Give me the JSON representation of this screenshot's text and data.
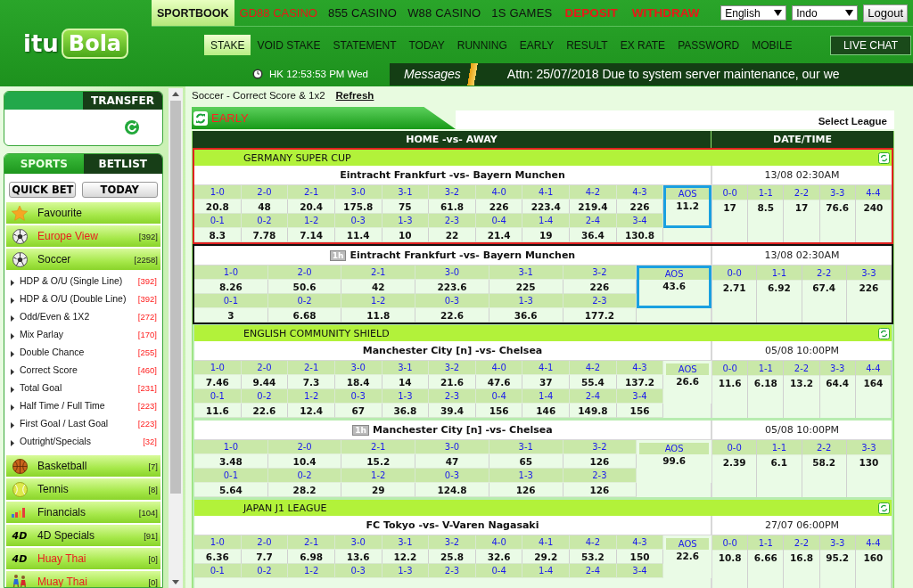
{
  "header": {
    "logo": {
      "part_1": "itu",
      "part_2": "Bola"
    },
    "top_nav": [
      {
        "label": "SPORTBOOK",
        "selected": true,
        "kind": "normal"
      },
      {
        "label": "GD88 CASINO",
        "selected": false,
        "kind": "promo"
      },
      {
        "label": "855 CASINO",
        "selected": false,
        "kind": "normal"
      },
      {
        "label": "W88 CASINO",
        "selected": false,
        "kind": "normal"
      },
      {
        "label": "1S GAMES",
        "selected": false,
        "kind": "normal"
      },
      {
        "label": "DEPOSIT",
        "selected": false,
        "kind": "alert"
      },
      {
        "label": "WITHDRAW",
        "selected": false,
        "kind": "alert"
      }
    ],
    "language_select": "English",
    "odds_select": "Indo",
    "logout": "Logout",
    "sub_nav": [
      {
        "label": "STAKE",
        "selected": true
      },
      {
        "label": "VOID STAKE",
        "selected": false
      },
      {
        "label": "STATEMENT",
        "selected": false
      },
      {
        "label": "TODAY",
        "selected": false
      },
      {
        "label": "RUNNING",
        "selected": false
      },
      {
        "label": "EARLY",
        "selected": false
      },
      {
        "label": "RESULT",
        "selected": false
      },
      {
        "label": "EX RATE",
        "selected": false
      },
      {
        "label": "PASSWORD",
        "selected": false
      },
      {
        "label": "MOBILE",
        "selected": false
      }
    ],
    "live_chat": "LIVE CHAT",
    "clock": "HK 12:53:53 PM Wed",
    "messages_label": "Messages",
    "message": "Attn: 25/07/2018 Due to system server maintenance, our we"
  },
  "sidebar": {
    "transfer_tab": "TRANSFER",
    "sports_tabs": [
      {
        "label": "SPORTS",
        "selected": true
      },
      {
        "label": "BETLIST",
        "selected": false
      }
    ],
    "buttons": [
      "QUICK BET",
      "TODAY"
    ],
    "sports": [
      {
        "kind": "favourite",
        "name": "Favourite",
        "highlight": false
      },
      {
        "kind": "soccer",
        "name": "Europe View",
        "count": "[392]",
        "highlight": true
      },
      {
        "kind": "soccer",
        "name": "Soccer",
        "count": "[2258]",
        "highlight": false,
        "children": [
          {
            "name": "HDP & O/U (Single Line)",
            "count": "[392]"
          },
          {
            "name": "HDP & O/U (Double Line)",
            "count": "[392]"
          },
          {
            "name": "Odd/Even & 1X2",
            "count": "[272]"
          },
          {
            "name": "Mix Parlay",
            "count": "[170]"
          },
          {
            "name": "Double Chance",
            "count": "[255]"
          },
          {
            "name": "Correct Score",
            "count": "[460]"
          },
          {
            "name": "Total Goal",
            "count": "[231]"
          },
          {
            "name": "Half Time / Full Time",
            "count": "[223]"
          },
          {
            "name": "First Goal / Last Goal",
            "count": "[223]"
          },
          {
            "name": "Outright/Specials",
            "count": "[32]"
          }
        ]
      },
      {
        "kind": "basketball",
        "name": "Basketball",
        "count": "[7]",
        "highlight": false
      },
      {
        "kind": "tennis",
        "name": "Tennis",
        "count": "[8]",
        "highlight": false
      },
      {
        "kind": "financials",
        "name": "Financials",
        "count": "[104]",
        "highlight": false
      },
      {
        "kind": "lottery",
        "icon_text": "4D",
        "name": "4D Specials",
        "count": "[91]",
        "highlight": false
      },
      {
        "kind": "lottery",
        "icon_text": "4D",
        "name": "Huay Thai",
        "count": "[0]",
        "highlight": true
      },
      {
        "kind": "boxing",
        "name": "Muay Thai",
        "count": "[0]",
        "highlight": true
      }
    ]
  },
  "main": {
    "breadcrumb": "Soccer - Correct Score & 1x2",
    "refresh_link": "Refresh",
    "section_tab": "EARLY",
    "select_league": "Select League",
    "columns": [
      "HOME -vs- AWAY",
      "DATE/TIME"
    ],
    "leagues": [
      {
        "name": "GERMANY SUPER CUP",
        "matches": [
          {
            "title": "Eintracht Frankfurt -vs- Bayern Munchen",
            "date": "13/08 02:30AM",
            "color": "#e02020",
            "aos_marked": true,
            "home": [
              {
                "label": "1-0",
                "odds": "20.8"
              },
              {
                "label": "2-0",
                "odds": "48"
              },
              {
                "label": "2-1",
                "odds": "20.4"
              },
              {
                "label": "3-0",
                "odds": "175.8"
              },
              {
                "label": "3-1",
                "odds": "75"
              },
              {
                "label": "3-2",
                "odds": "61.8"
              },
              {
                "label": "4-0",
                "odds": "226"
              },
              {
                "label": "4-1",
                "odds": "223.4"
              },
              {
                "label": "4-2",
                "odds": "219.4"
              },
              {
                "label": "4-3",
                "odds": "226"
              }
            ],
            "away": [
              {
                "label": "0-1",
                "odds": "8.3"
              },
              {
                "label": "0-2",
                "odds": "7.78"
              },
              {
                "label": "1-2",
                "odds": "7.14"
              },
              {
                "label": "0-3",
                "odds": "11.4"
              },
              {
                "label": "1-3",
                "odds": "10"
              },
              {
                "label": "2-3",
                "odds": "22"
              },
              {
                "label": "0-4",
                "odds": "21.4"
              },
              {
                "label": "1-4",
                "odds": "19"
              },
              {
                "label": "2-4",
                "odds": "36.4"
              },
              {
                "label": "3-4",
                "odds": "130.8"
              }
            ],
            "aos": {
              "label": "AOS",
              "odds": "11.2"
            },
            "draws": [
              {
                "label": "0-0",
                "odds": "17"
              },
              {
                "label": "1-1",
                "odds": "8.5"
              },
              {
                "label": "2-2",
                "odds": "17"
              },
              {
                "label": "3-3",
                "odds": "76.6"
              },
              {
                "label": "4-4",
                "odds": "240"
              }
            ]
          },
          {
            "half": "1h",
            "title": "Eintracht Frankfurt -vs- Bayern Munchen",
            "date": "13/08 02:30AM",
            "color": "#111111",
            "aos_marked": true,
            "home": [
              {
                "label": "1-0",
                "odds": "8.26"
              },
              {
                "label": "2-0",
                "odds": "50.6"
              },
              {
                "label": "2-1",
                "odds": "42"
              },
              {
                "label": "3-0",
                "odds": "223.6"
              },
              {
                "label": "3-1",
                "odds": "225"
              },
              {
                "label": "3-2",
                "odds": "226"
              }
            ],
            "away": [
              {
                "label": "0-1",
                "odds": "3"
              },
              {
                "label": "0-2",
                "odds": "6.68"
              },
              {
                "label": "1-2",
                "odds": "11.8"
              },
              {
                "label": "0-3",
                "odds": "22.6"
              },
              {
                "label": "1-3",
                "odds": "36.6"
              },
              {
                "label": "2-3",
                "odds": "177.2"
              }
            ],
            "aos": {
              "label": "AOS",
              "odds": "43.6"
            },
            "draws": [
              {
                "label": "0-0",
                "odds": "2.71"
              },
              {
                "label": "1-1",
                "odds": "6.92"
              },
              {
                "label": "2-2",
                "odds": "67.4"
              },
              {
                "label": "3-3",
                "odds": "226"
              }
            ]
          }
        ]
      },
      {
        "name": "ENGLISH COMMUNITY SHIELD",
        "matches": [
          {
            "title": "Manchester City [n] -vs- Chelsea",
            "date": "05/08 10:00PM",
            "aos_marked": false,
            "home": [
              {
                "label": "1-0",
                "odds": "7.46"
              },
              {
                "label": "2-0",
                "odds": "9.44"
              },
              {
                "label": "2-1",
                "odds": "7.3"
              },
              {
                "label": "3-0",
                "odds": "18.4"
              },
              {
                "label": "3-1",
                "odds": "14"
              },
              {
                "label": "3-2",
                "odds": "21.6"
              },
              {
                "label": "4-0",
                "odds": "47.6"
              },
              {
                "label": "4-1",
                "odds": "37"
              },
              {
                "label": "4-2",
                "odds": "55.4"
              },
              {
                "label": "4-3",
                "odds": "137.2"
              }
            ],
            "away": [
              {
                "label": "0-1",
                "odds": "11.6"
              },
              {
                "label": "0-2",
                "odds": "22.6"
              },
              {
                "label": "1-2",
                "odds": "12.4"
              },
              {
                "label": "0-3",
                "odds": "67"
              },
              {
                "label": "1-3",
                "odds": "36.8"
              },
              {
                "label": "2-3",
                "odds": "39.4"
              },
              {
                "label": "0-4",
                "odds": "156"
              },
              {
                "label": "1-4",
                "odds": "146"
              },
              {
                "label": "2-4",
                "odds": "149.8"
              },
              {
                "label": "3-4",
                "odds": "156"
              }
            ],
            "aos": {
              "label": "AOS",
              "odds": "26.6"
            },
            "draws": [
              {
                "label": "0-0",
                "odds": "11.6"
              },
              {
                "label": "1-1",
                "odds": "6.18"
              },
              {
                "label": "2-2",
                "odds": "13.2"
              },
              {
                "label": "3-3",
                "odds": "64.4"
              },
              {
                "label": "4-4",
                "odds": "164"
              }
            ]
          },
          {
            "half": "1h",
            "title": "Manchester City [n] -vs- Chelsea",
            "date": "05/08 10:00PM",
            "aos_marked": false,
            "home": [
              {
                "label": "1-0",
                "odds": "3.48"
              },
              {
                "label": "2-0",
                "odds": "10.4"
              },
              {
                "label": "2-1",
                "odds": "15.2"
              },
              {
                "label": "3-0",
                "odds": "47"
              },
              {
                "label": "3-1",
                "odds": "65"
              },
              {
                "label": "3-2",
                "odds": "126"
              }
            ],
            "away": [
              {
                "label": "0-1",
                "odds": "5.64"
              },
              {
                "label": "0-2",
                "odds": "28.2"
              },
              {
                "label": "1-2",
                "odds": "29"
              },
              {
                "label": "0-3",
                "odds": "124.8"
              },
              {
                "label": "1-3",
                "odds": "126"
              },
              {
                "label": "2-3",
                "odds": "126"
              }
            ],
            "aos": {
              "label": "AOS",
              "odds": "99.6"
            },
            "draws": [
              {
                "label": "0-0",
                "odds": "2.39"
              },
              {
                "label": "1-1",
                "odds": "6.1"
              },
              {
                "label": "2-2",
                "odds": "58.2"
              },
              {
                "label": "3-3",
                "odds": "130"
              }
            ]
          }
        ]
      },
      {
        "name": "JAPAN J1 LEAGUE",
        "matches": [
          {
            "title": "FC Tokyo -vs- V-Varen Nagasaki",
            "date": "27/07 06:00PM",
            "aos_marked": false,
            "home": [
              {
                "label": "1-0",
                "odds": "6.36"
              },
              {
                "label": "2-0",
                "odds": "7.7"
              },
              {
                "label": "2-1",
                "odds": "6.98"
              },
              {
                "label": "3-0",
                "odds": "13.6"
              },
              {
                "label": "3-1",
                "odds": "12.2"
              },
              {
                "label": "3-2",
                "odds": "25.8"
              },
              {
                "label": "4-0",
                "odds": "32.6"
              },
              {
                "label": "4-1",
                "odds": "29.2"
              },
              {
                "label": "4-2",
                "odds": "53.2"
              },
              {
                "label": "4-3",
                "odds": "150"
              }
            ],
            "away": [
              {
                "label": "0-1"
              },
              {
                "label": "0-2"
              },
              {
                "label": "1-2"
              },
              {
                "label": "0-3"
              },
              {
                "label": "1-3"
              },
              {
                "label": "2-3"
              },
              {
                "label": "0-4"
              },
              {
                "label": "1-4"
              },
              {
                "label": "2-4"
              },
              {
                "label": "3-4"
              }
            ],
            "aos": {
              "label": "AOS",
              "odds": "22.6"
            },
            "draws": [
              {
                "label": "0-0",
                "odds": "10.8"
              },
              {
                "label": "1-1",
                "odds": "6.66"
              },
              {
                "label": "2-2",
                "odds": "16.8"
              },
              {
                "label": "3-3",
                "odds": "95.2"
              },
              {
                "label": "4-4",
                "odds": "160"
              }
            ]
          }
        ]
      }
    ]
  }
}
